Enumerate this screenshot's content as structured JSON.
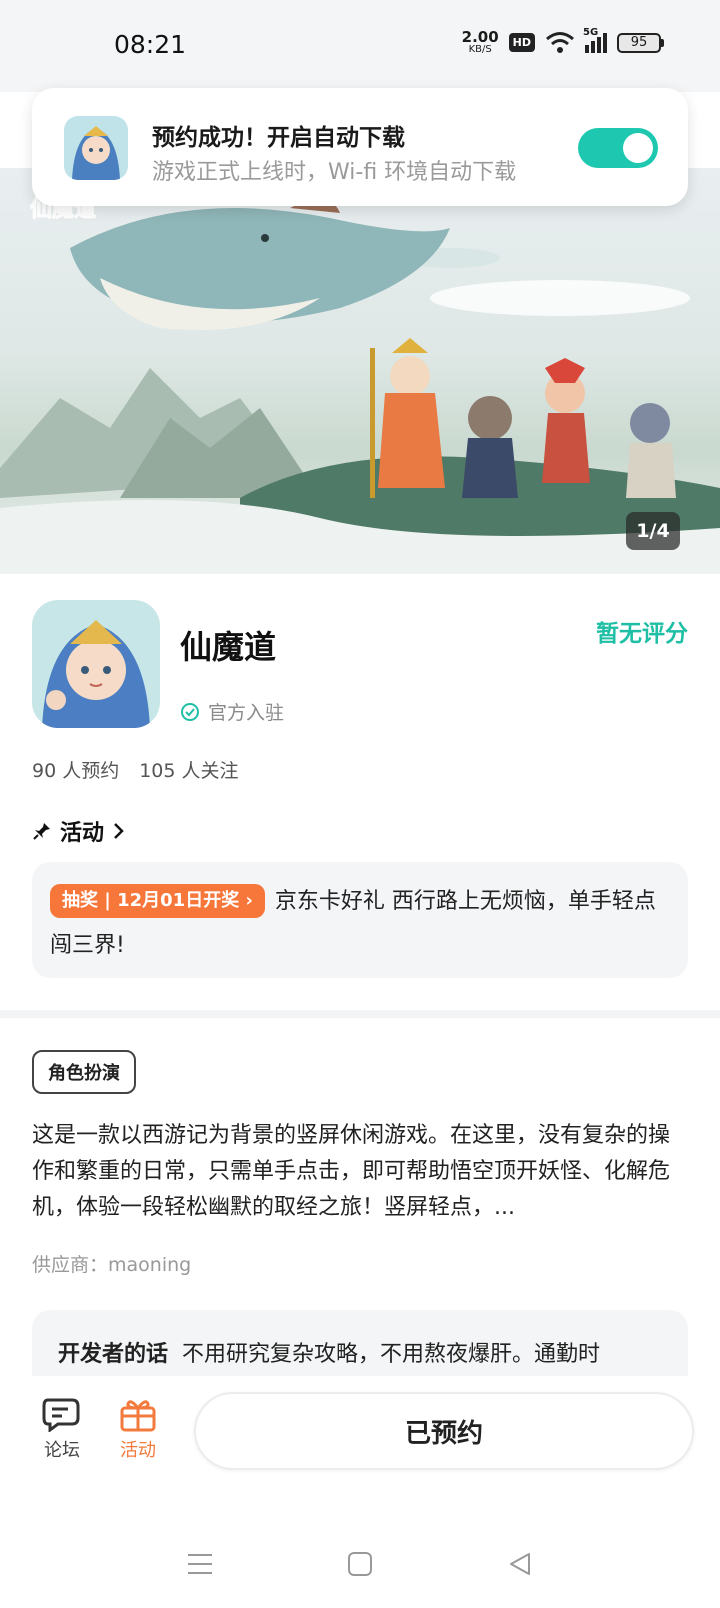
{
  "status_bar": {
    "time": "08:21",
    "net_speed_value": "2.00",
    "net_speed_unit": "KB/S",
    "hd": "HD",
    "network": "5G",
    "battery": "95"
  },
  "notification": {
    "title": "预约成功！开启自动下载",
    "subtitle": "游戏正式上线时，Wi-fi 环境自动下载",
    "auto_download_enabled": true,
    "accent_color": "#1ec8b0"
  },
  "banner": {
    "page_indicator": "1/4"
  },
  "app": {
    "name": "仙魔道",
    "rating": "暂无评分",
    "official_label": "官方入驻",
    "reservations": "90 人预约",
    "followers": "105 人关注"
  },
  "activity": {
    "header": "活动",
    "tag": "抽奖 | 12月01日开奖",
    "text": "京东卡好礼 西行路上无烦恼，单手轻点闯三界!"
  },
  "details": {
    "genre": "角色扮演",
    "description": "这是一款以西游记为背景的竖屏休闲游戏。在这里，没有复杂的操作和繁重的日常，只需单手点击，即可帮助悟空顶开妖怪、化解危机，体验一段轻松幽默的取经之旅！竖屏轻点，...",
    "supplier": "供应商：maoning"
  },
  "developer": {
    "label": "开发者的话",
    "text": "不用研究复杂攻略，不用熬夜爆肝。通勤时"
  },
  "bottom_bar": {
    "forum_label": "论坛",
    "activity_label": "活动",
    "reserve_button": "已预约"
  },
  "colors": {
    "teal": "#1fbfa6",
    "orange": "#f7763a"
  }
}
